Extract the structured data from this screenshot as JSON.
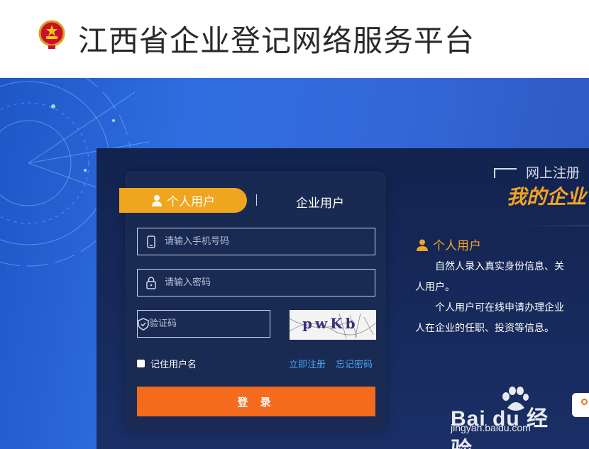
{
  "header": {
    "title": "江西省企业登记网络服务平台",
    "emblem_icon": "national-emblem-icon"
  },
  "login": {
    "tabs": [
      {
        "label": "个人用户",
        "active": true,
        "icon": "user-icon"
      },
      {
        "label": "企业用户",
        "active": false
      }
    ],
    "phone_placeholder": "请输入手机号码",
    "password_placeholder": "请输入密码",
    "captcha_placeholder": "验证码",
    "captcha_text": "pwKb",
    "remember_label": "记住用户名",
    "register_link": "立即注册",
    "forgot_link": "忘记密码",
    "login_button": "登 录"
  },
  "info": {
    "kicker": "网上注册",
    "slogan": "我的企业",
    "section_title": "个人用户",
    "paragraph1_line1": "自然人录入真实身份信息、关",
    "paragraph1_line2": "人用户。",
    "paragraph2_line1": "个人用户可在线申请办理企业",
    "paragraph2_line2": "人在企业的任职、投资等信息。"
  },
  "watermark": {
    "brand": "Bai du 经验",
    "url": "jingyan.baidu.com"
  },
  "colors": {
    "accent_orange": "#f46b1d",
    "tab_gold": "#f0a51e",
    "link_blue": "#48a6f0",
    "panel_navy": "#12234f"
  }
}
